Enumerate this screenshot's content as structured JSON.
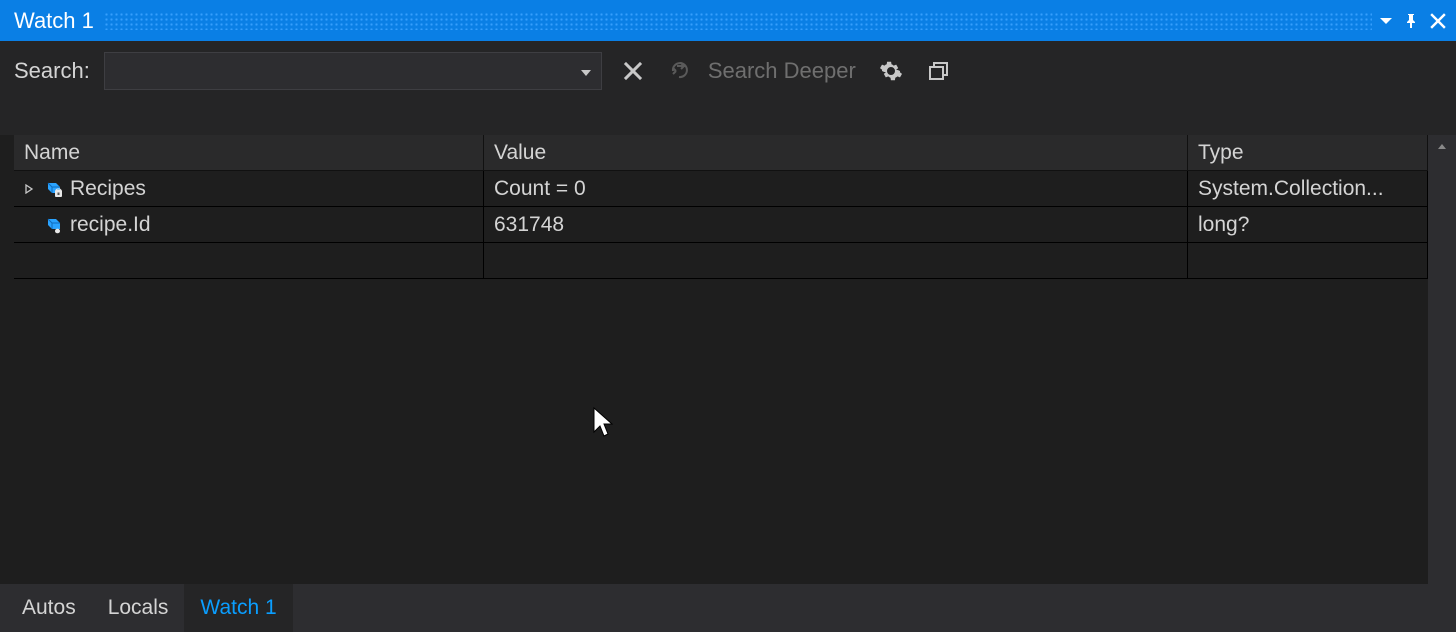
{
  "title": "Watch 1",
  "toolbar": {
    "search_label": "Search:",
    "search_value": "",
    "search_deeper_label": "Search Deeper"
  },
  "columns": [
    "Name",
    "Value",
    "Type"
  ],
  "rows": [
    {
      "expandable": true,
      "icon": "field-private",
      "name": "Recipes",
      "value": "Count = 0",
      "type": "System.Collection..."
    },
    {
      "expandable": false,
      "icon": "field-public",
      "name": "recipe.Id",
      "value": "631748",
      "type": "long?"
    }
  ],
  "tabs": [
    {
      "label": "Autos",
      "active": false
    },
    {
      "label": "Locals",
      "active": false
    },
    {
      "label": "Watch 1",
      "active": true
    }
  ]
}
